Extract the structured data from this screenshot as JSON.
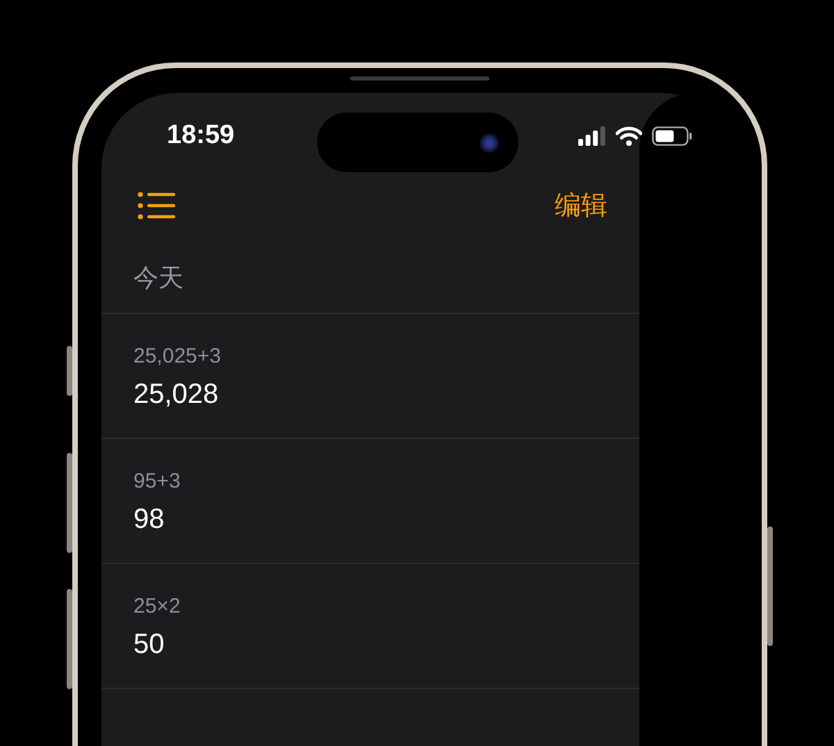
{
  "status_bar": {
    "time": "18:59"
  },
  "nav": {
    "edit": "编辑"
  },
  "section_title": "今天",
  "history": [
    {
      "expression": "25,025+3",
      "result": "25,028"
    },
    {
      "expression": "95+3",
      "result": "98"
    },
    {
      "expression": "25×2",
      "result": "50"
    }
  ]
}
